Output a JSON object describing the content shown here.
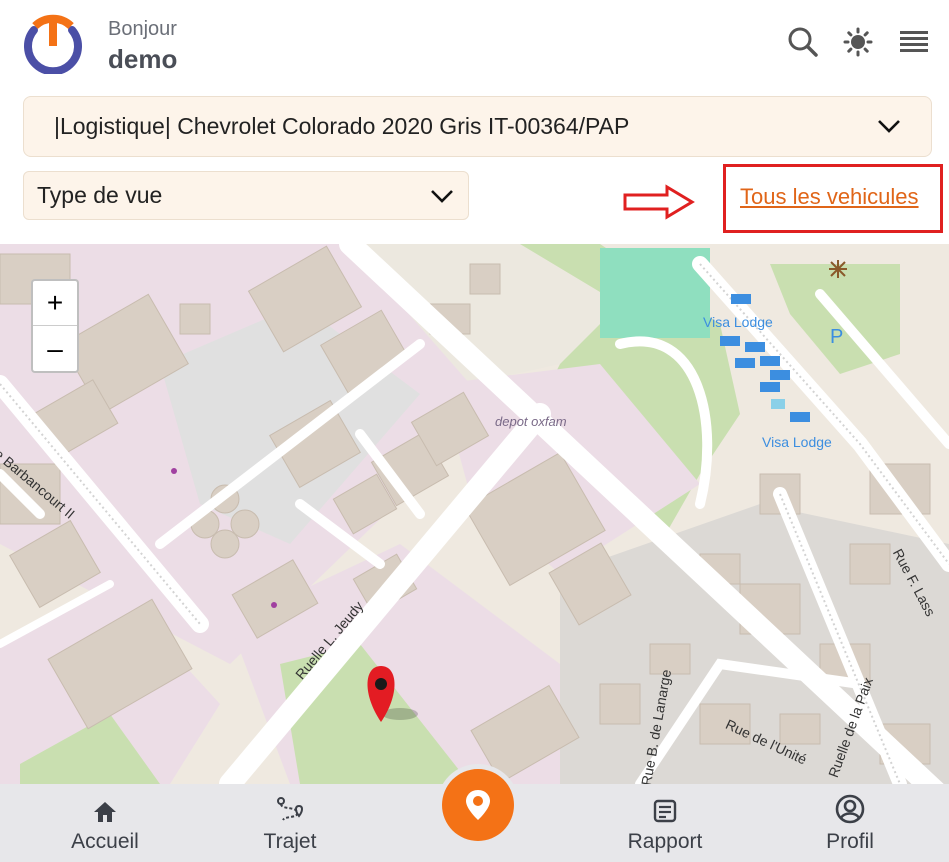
{
  "header": {
    "greeting": "Bonjour",
    "username": "demo",
    "icons": [
      "search-icon",
      "brightness-icon",
      "menu-icon"
    ]
  },
  "filters": {
    "vehicle_selected": "|Logistique| Chevrolet Colorado 2020 Gris IT-00364/PAP",
    "view_type_selected": "Type de vue",
    "all_vehicles_link": "Tous les vehicules"
  },
  "map": {
    "zoom_in": "+",
    "zoom_out": "–",
    "labels": {
      "depot": "depot oxfam",
      "lodge_1": "Visa Lodge",
      "lodge_2": "Visa Lodge",
      "parking": "P",
      "street_barbancourt": "Rue Barbancourt II",
      "street_jeudy": "Ruelle L. Jeudy",
      "street_lanarge": "Rue B. de Lanarge",
      "street_unite": "Rue de l'Unité",
      "street_paix": "Ruelle de la Paix",
      "street_lass": "Rue F. Lass"
    }
  },
  "nav": {
    "home": "Accueil",
    "trip": "Trajet",
    "report": "Rapport",
    "profile": "Profil"
  },
  "colors": {
    "accent": "#f47216",
    "logo_blue": "#4b4fa6",
    "link": "#e06518",
    "highlight_red": "#e02020"
  }
}
